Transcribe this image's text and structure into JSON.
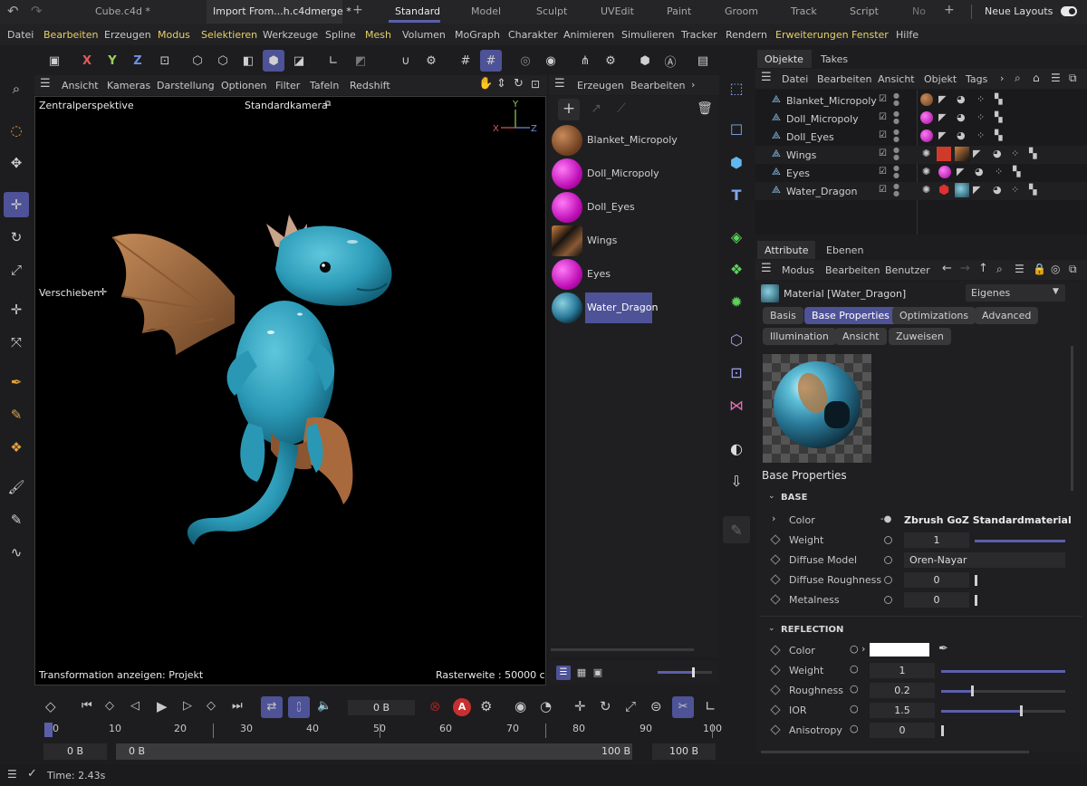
{
  "tabs": {
    "undo": "↶",
    "redo": "↷",
    "doc1": "Cube.c4d *",
    "doc2": "Import From...h.c4dmerge *",
    "add": "+",
    "layouts": [
      "Standard",
      "Model",
      "Sculpt",
      "UVEdit",
      "Paint",
      "Groom",
      "Track",
      "Script",
      "No"
    ],
    "neue_layouts": "Neue Layouts"
  },
  "menu": [
    "Datei",
    "Bearbeiten",
    "Erzeugen",
    "Modus",
    "Selektieren",
    "Werkzeuge",
    "Spline",
    "Mesh",
    "Volumen",
    "MoGraph",
    "Charakter",
    "Animieren",
    "Simulieren",
    "Tracker",
    "Rendern",
    "Erweiterungen",
    "Fenster",
    "Hilfe"
  ],
  "toolbar": {
    "x": "X",
    "y": "Y",
    "z": "Z"
  },
  "viewport": {
    "menu": [
      "Ansicht",
      "Kameras",
      "Darstellung",
      "Optionen",
      "Filter",
      "Tafeln",
      "Redshift"
    ],
    "projection": "Zentralperspektive",
    "camera": "Standardkamera",
    "tool_label": "Verschieben",
    "transform_info": "Transformation anzeigen: Projekt",
    "grid_info": "Rasterweite : 50000 cm",
    "axis_x": "X",
    "axis_y": "Y",
    "axis_z": "Z"
  },
  "material_manager": {
    "menu": [
      "Erzeugen",
      "Bearbeiten"
    ],
    "materials": [
      {
        "name": "Blanket_Micropoly",
        "color": "#7a4a2a"
      },
      {
        "name": "Doll_Micropoly",
        "color": "#e019d8"
      },
      {
        "name": "Doll_Eyes",
        "color": "#e019d8"
      },
      {
        "name": "Wings",
        "color": "#3a2a1a"
      },
      {
        "name": "Eyes",
        "color": "#e019d8"
      },
      {
        "name": "Water_Dragon",
        "color": "#2a7a9a"
      }
    ],
    "selected": "Water_Dragon"
  },
  "objects": {
    "tabs": [
      "Objekte",
      "Takes"
    ],
    "menu": [
      "Datei",
      "Bearbeiten",
      "Ansicht",
      "Objekt",
      "Tags"
    ],
    "items": [
      "Blanket_Micropoly",
      "Doll_Micropoly",
      "Doll_Eyes",
      "Wings",
      "Eyes",
      "Water_Dragon"
    ]
  },
  "attributes": {
    "tabs": [
      "Attribute",
      "Ebenen"
    ],
    "menu": [
      "Modus",
      "Bearbeiten",
      "Benutzer"
    ],
    "title": "Material [Water_Dragon]",
    "mode_select": "Eigenes",
    "subtabs_row1": [
      "Basis",
      "Base Properties",
      "Optimizations",
      "Advanced"
    ],
    "subtabs_row2": [
      "Illumination",
      "Ansicht",
      "Zuweisen"
    ],
    "active_subtab": "Base Properties",
    "preview_caption": "Base Properties",
    "base": {
      "header": "BASE",
      "color_label": "Color",
      "color_value": "Zbrush GoZ Standardmaterial",
      "weight_label": "Weight",
      "weight": "1",
      "diffuse_model_label": "Diffuse Model",
      "diffuse_model": "Oren-Nayar",
      "diffuse_roughness_label": "Diffuse Roughness",
      "diffuse_roughness": "0",
      "metalness_label": "Metalness",
      "metalness": "0"
    },
    "reflection": {
      "header": "REFLECTION",
      "color_label": "Color",
      "weight_label": "Weight",
      "weight": "1",
      "roughness_label": "Roughness",
      "roughness": "0.2",
      "ior_label": "IOR",
      "ior": "1.5",
      "anisotropy_label": "Anisotropy",
      "anisotropy": "0"
    }
  },
  "timeline": {
    "current_frame": "0 B",
    "ticks": [
      "0",
      "10",
      "20",
      "30",
      "40",
      "50",
      "60",
      "70",
      "80",
      "90",
      "100"
    ],
    "range_start": "0 B",
    "range_min": "0 B",
    "range_max": "100 B",
    "range_end": "100 B"
  },
  "status": {
    "time": "Time: 2.43s"
  }
}
